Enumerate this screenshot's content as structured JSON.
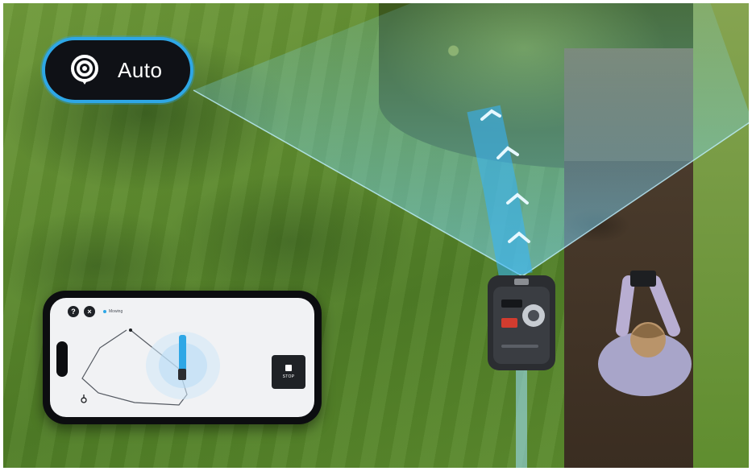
{
  "mode_badge": {
    "label": "Auto",
    "icon": "signal-pin-icon",
    "accent": "#2ea7e6"
  },
  "phone_app": {
    "help_button_label": "?",
    "close_button_label": "×",
    "status_text": "Mowing",
    "stop_button": {
      "label": "STOP",
      "icon": "stop-square-icon"
    }
  },
  "colors": {
    "beam": "#5fd0ff",
    "dark_ui": "#0f1116",
    "grass": "#5d8a2e"
  }
}
